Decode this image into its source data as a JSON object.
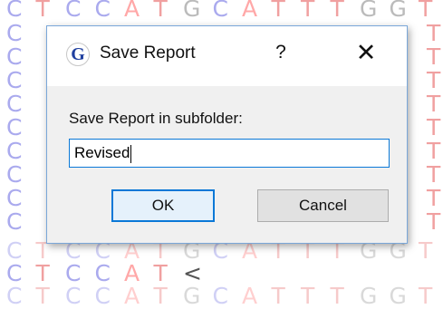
{
  "background_sequence": {
    "top_row": [
      "C",
      "T",
      "C",
      "C",
      "A",
      "T",
      "G",
      "C",
      "A",
      "T",
      "T",
      "T",
      "G",
      "G",
      "T"
    ],
    "bottom_row": [
      "C",
      "T",
      "C",
      "C",
      "A",
      "T",
      "<"
    ],
    "right_column": [
      "T",
      "T",
      "T",
      "T",
      "T",
      "T",
      "T",
      "T",
      "T"
    ],
    "colors": {
      "C": "#aaaaee",
      "T": "#f0a0a0",
      "A": "#ffa8a8",
      "G": "#bbbbbb"
    }
  },
  "dialog": {
    "title": "Save Report",
    "app_icon_letter": "G",
    "help_label": "?",
    "close_label": "✕",
    "prompt_label": "Save Report in subfolder:",
    "input_value": "Revised",
    "ok_label": "OK",
    "cancel_label": "Cancel",
    "accent_color": "#0a78d7"
  }
}
